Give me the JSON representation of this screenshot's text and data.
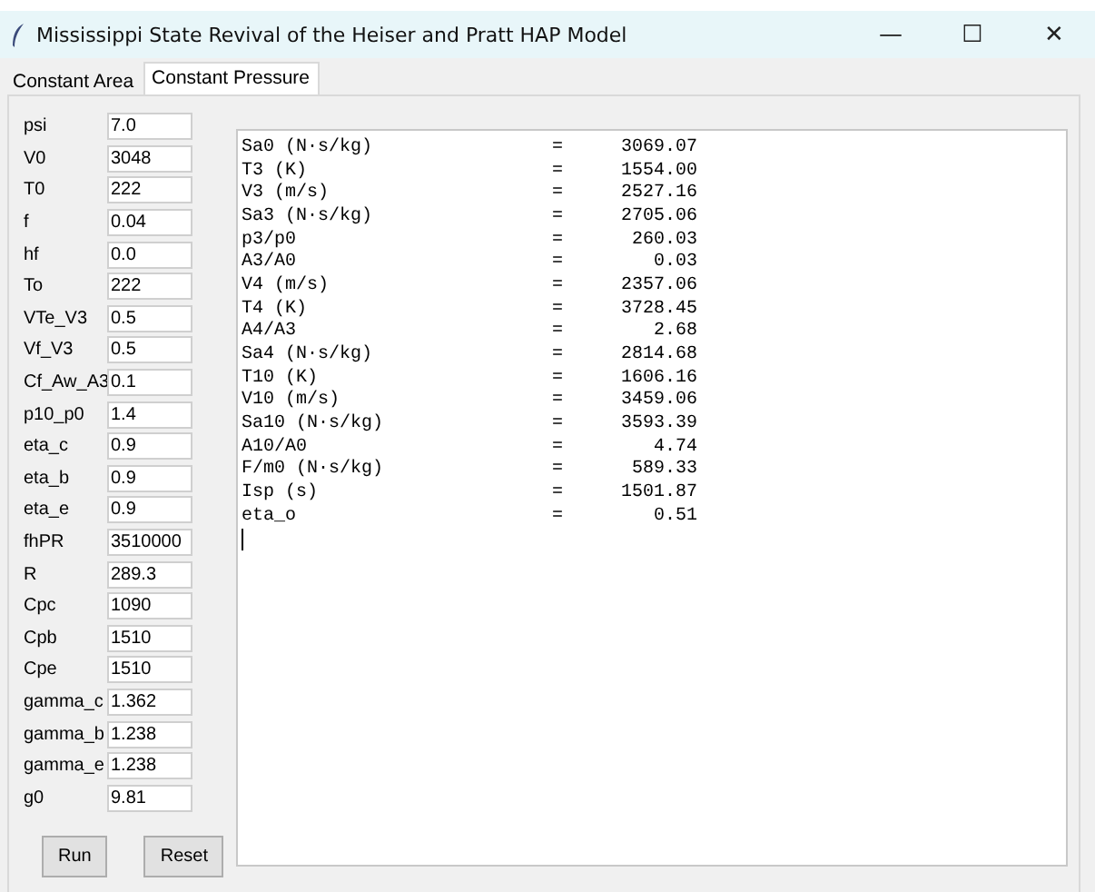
{
  "window": {
    "title": "Mississippi State Revival of the Heiser and Pratt HAP Model",
    "controls": [
      "—",
      "☐",
      "✕"
    ]
  },
  "tabs": [
    {
      "label": "Constant Area",
      "selected": false
    },
    {
      "label": "Constant Pressure",
      "selected": true
    }
  ],
  "inputs": [
    {
      "label": "psi",
      "value": "7.0"
    },
    {
      "label": "V0",
      "value": "3048"
    },
    {
      "label": "T0",
      "value": "222"
    },
    {
      "label": "f",
      "value": "0.04"
    },
    {
      "label": "hf",
      "value": "0.0"
    },
    {
      "label": "To",
      "value": "222"
    },
    {
      "label": "VTe_V3",
      "value": "0.5"
    },
    {
      "label": "Vf_V3",
      "value": "0.5"
    },
    {
      "label": "Cf_Aw_A3",
      "value": "0.1"
    },
    {
      "label": "p10_p0",
      "value": "1.4"
    },
    {
      "label": "eta_c",
      "value": "0.9"
    },
    {
      "label": "eta_b",
      "value": "0.9"
    },
    {
      "label": "eta_e",
      "value": "0.9"
    },
    {
      "label": "fhPR",
      "value": "3510000"
    },
    {
      "label": "R",
      "value": "289.3"
    },
    {
      "label": "Cpc",
      "value": "1090"
    },
    {
      "label": "Cpb",
      "value": "1510"
    },
    {
      "label": "Cpe",
      "value": "1510"
    },
    {
      "label": "gamma_c",
      "value": "1.362"
    },
    {
      "label": "gamma_b",
      "value": "1.238"
    },
    {
      "label": "gamma_e",
      "value": "1.238"
    },
    {
      "label": "g0",
      "value": "9.81"
    }
  ],
  "buttons": [
    "Run",
    "Reset"
  ],
  "output": [
    {
      "name": "Sa0 (N·s/kg)",
      "eq": "=",
      "value": "3069.07"
    },
    {
      "name": "T3 (K)",
      "eq": "=",
      "value": "1554.00"
    },
    {
      "name": "V3 (m/s)",
      "eq": "=",
      "value": "2527.16"
    },
    {
      "name": "Sa3 (N·s/kg)",
      "eq": "=",
      "value": "2705.06"
    },
    {
      "name": "p3/p0",
      "eq": "=",
      "value": "260.03"
    },
    {
      "name": "A3/A0",
      "eq": "=",
      "value": "0.03"
    },
    {
      "name": "V4 (m/s)",
      "eq": "=",
      "value": "2357.06"
    },
    {
      "name": "T4 (K)",
      "eq": "=",
      "value": "3728.45"
    },
    {
      "name": "A4/A3",
      "eq": "=",
      "value": "2.68"
    },
    {
      "name": "Sa4 (N·s/kg)",
      "eq": "=",
      "value": "2814.68"
    },
    {
      "name": "T10 (K)",
      "eq": "=",
      "value": "1606.16"
    },
    {
      "name": "V10 (m/s)",
      "eq": "=",
      "value": "3459.06"
    },
    {
      "name": "Sa10 (N·s/kg)",
      "eq": "=",
      "value": "3593.39"
    },
    {
      "name": "A10/A0",
      "eq": "=",
      "value": "4.74"
    },
    {
      "name": "F/m0 (N·s/kg)",
      "eq": "=",
      "value": "589.33"
    },
    {
      "name": "Isp (s)",
      "eq": "=",
      "value": "1501.87"
    },
    {
      "name": "eta_o",
      "eq": "=",
      "value": "0.51"
    }
  ]
}
